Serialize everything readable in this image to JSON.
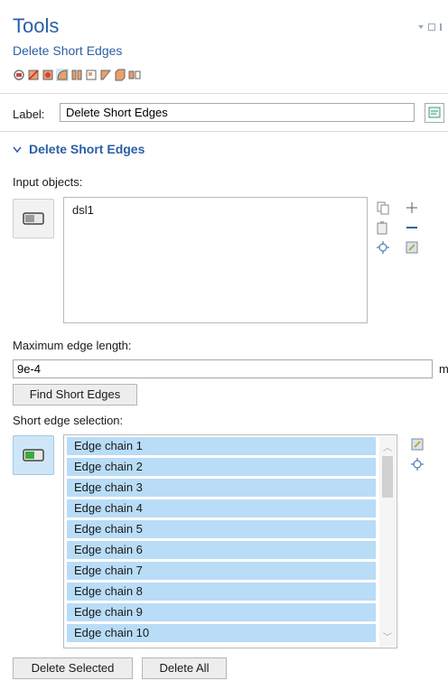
{
  "header": {
    "title": "Tools",
    "subtitle": "Delete Short Edges"
  },
  "toolbar_icons": [
    "virtual-ops-icon",
    "edge-icon",
    "face-icon",
    "fillet-icon",
    "split-icon",
    "merge-icon",
    "collapse-icon",
    "solid-icon",
    "ignore-icon"
  ],
  "label_row": {
    "label": "Label:",
    "value": "Delete Short Edges"
  },
  "section": {
    "title": "Delete Short Edges"
  },
  "input_objects": {
    "label": "Input objects:",
    "items": [
      "dsl1"
    ]
  },
  "max_edge": {
    "label": "Maximum edge length:",
    "value": "9e-4",
    "unit": "m"
  },
  "buttons": {
    "find": "Find Short Edges",
    "delete_selected": "Delete Selected",
    "delete_all": "Delete All"
  },
  "short_edge": {
    "label": "Short edge selection:",
    "items": [
      "Edge chain 1",
      "Edge chain 2",
      "Edge chain 3",
      "Edge chain 4",
      "Edge chain 5",
      "Edge chain 6",
      "Edge chain 7",
      "Edge chain 8",
      "Edge chain 9",
      "Edge chain 10"
    ]
  },
  "colors": {
    "accent": "#2a5fa5",
    "selection": "#b9dcf7"
  }
}
